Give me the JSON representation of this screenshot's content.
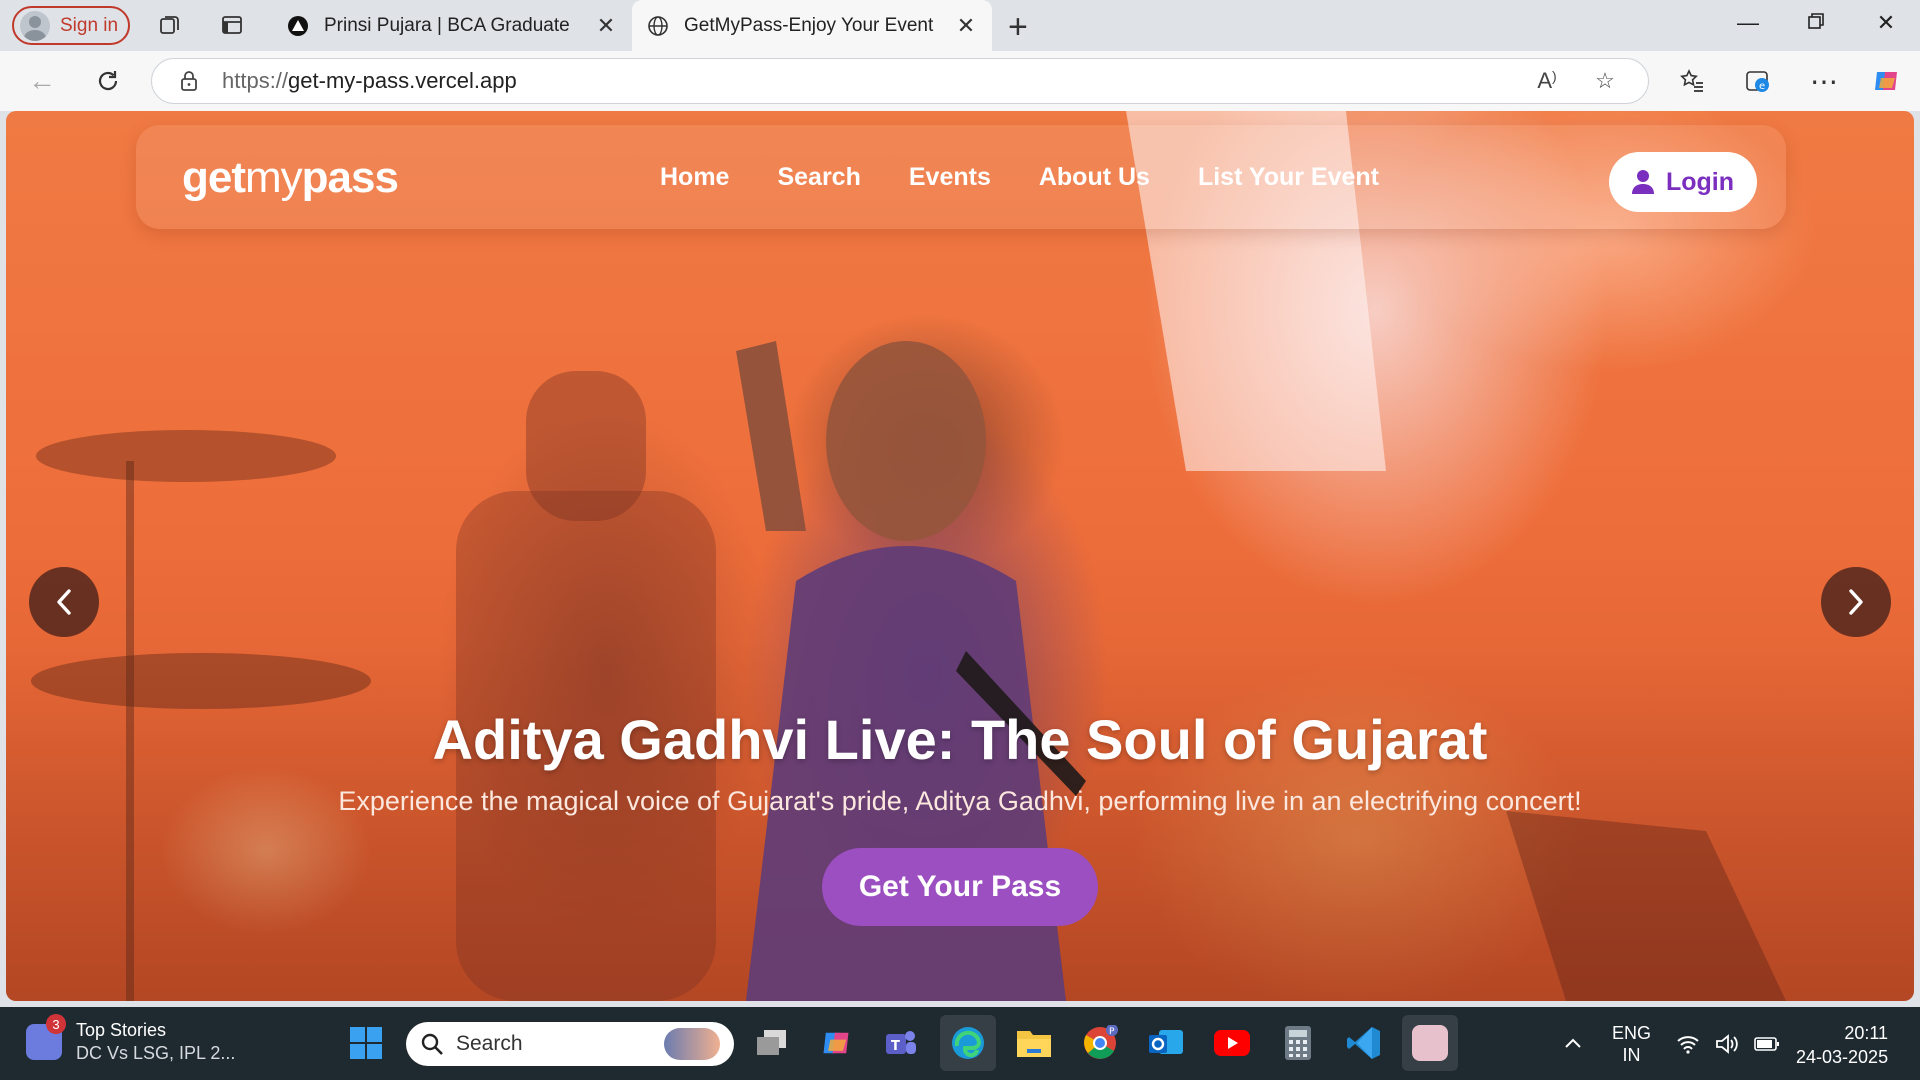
{
  "browser": {
    "signin_label": "Sign in",
    "tabs": [
      {
        "title": "Prinsi Pujara | BCA Graduate",
        "favicon": "triangle-logo-icon"
      },
      {
        "title": "GetMyPass-Enjoy Your Event",
        "favicon": "globe-icon"
      }
    ],
    "url_protocol": "https://",
    "url_host": "get-my-pass.vercel.app"
  },
  "site": {
    "logo_bold": "get",
    "logo_light": "my",
    "logo_bold2": "pass",
    "nav": [
      "Home",
      "Search",
      "Events",
      "About Us",
      "List Your Event"
    ],
    "login_label": "Login",
    "hero": {
      "title": "Aditya Gadhvi Live: The Soul of Gujarat",
      "subtitle": "Experience the magical voice of Gujarat's pride, Aditya Gadhvi, performing live in an electrifying concert!",
      "cta": "Get Your Pass"
    },
    "colors": {
      "accent": "#9b4fc0",
      "login_text": "#7b2fbf",
      "hero_bg": "#ee6e3b"
    }
  },
  "taskbar": {
    "news_badge": "3",
    "news_title": "Top Stories",
    "news_sub": "DC Vs LSG, IPL 2...",
    "search_placeholder": "Search",
    "lang_top": "ENG",
    "lang_bottom": "IN",
    "time": "20:11",
    "date": "24-03-2025"
  }
}
